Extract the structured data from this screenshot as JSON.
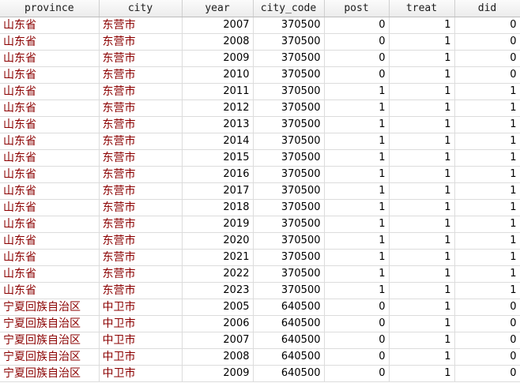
{
  "columns": [
    "province",
    "city",
    "year",
    "city_code",
    "post",
    "treat",
    "did"
  ],
  "rows": [
    [
      "山东省",
      "东营市",
      "2007",
      "370500",
      "0",
      "1",
      "0"
    ],
    [
      "山东省",
      "东营市",
      "2008",
      "370500",
      "0",
      "1",
      "0"
    ],
    [
      "山东省",
      "东营市",
      "2009",
      "370500",
      "0",
      "1",
      "0"
    ],
    [
      "山东省",
      "东营市",
      "2010",
      "370500",
      "0",
      "1",
      "0"
    ],
    [
      "山东省",
      "东营市",
      "2011",
      "370500",
      "1",
      "1",
      "1"
    ],
    [
      "山东省",
      "东营市",
      "2012",
      "370500",
      "1",
      "1",
      "1"
    ],
    [
      "山东省",
      "东营市",
      "2013",
      "370500",
      "1",
      "1",
      "1"
    ],
    [
      "山东省",
      "东营市",
      "2014",
      "370500",
      "1",
      "1",
      "1"
    ],
    [
      "山东省",
      "东营市",
      "2015",
      "370500",
      "1",
      "1",
      "1"
    ],
    [
      "山东省",
      "东营市",
      "2016",
      "370500",
      "1",
      "1",
      "1"
    ],
    [
      "山东省",
      "东营市",
      "2017",
      "370500",
      "1",
      "1",
      "1"
    ],
    [
      "山东省",
      "东营市",
      "2018",
      "370500",
      "1",
      "1",
      "1"
    ],
    [
      "山东省",
      "东营市",
      "2019",
      "370500",
      "1",
      "1",
      "1"
    ],
    [
      "山东省",
      "东营市",
      "2020",
      "370500",
      "1",
      "1",
      "1"
    ],
    [
      "山东省",
      "东营市",
      "2021",
      "370500",
      "1",
      "1",
      "1"
    ],
    [
      "山东省",
      "东营市",
      "2022",
      "370500",
      "1",
      "1",
      "1"
    ],
    [
      "山东省",
      "东营市",
      "2023",
      "370500",
      "1",
      "1",
      "1"
    ],
    [
      "宁夏回族自治区",
      "中卫市",
      "2005",
      "640500",
      "0",
      "1",
      "0"
    ],
    [
      "宁夏回族自治区",
      "中卫市",
      "2006",
      "640500",
      "0",
      "1",
      "0"
    ],
    [
      "宁夏回族自治区",
      "中卫市",
      "2007",
      "640500",
      "0",
      "1",
      "0"
    ],
    [
      "宁夏回族自治区",
      "中卫市",
      "2008",
      "640500",
      "0",
      "1",
      "0"
    ],
    [
      "宁夏回族自治区",
      "中卫市",
      "2009",
      "640500",
      "0",
      "1",
      "0"
    ]
  ],
  "colors": {
    "string_text": "#8b0000",
    "number_text": "#000000",
    "header_text": "#1a1a1a"
  }
}
